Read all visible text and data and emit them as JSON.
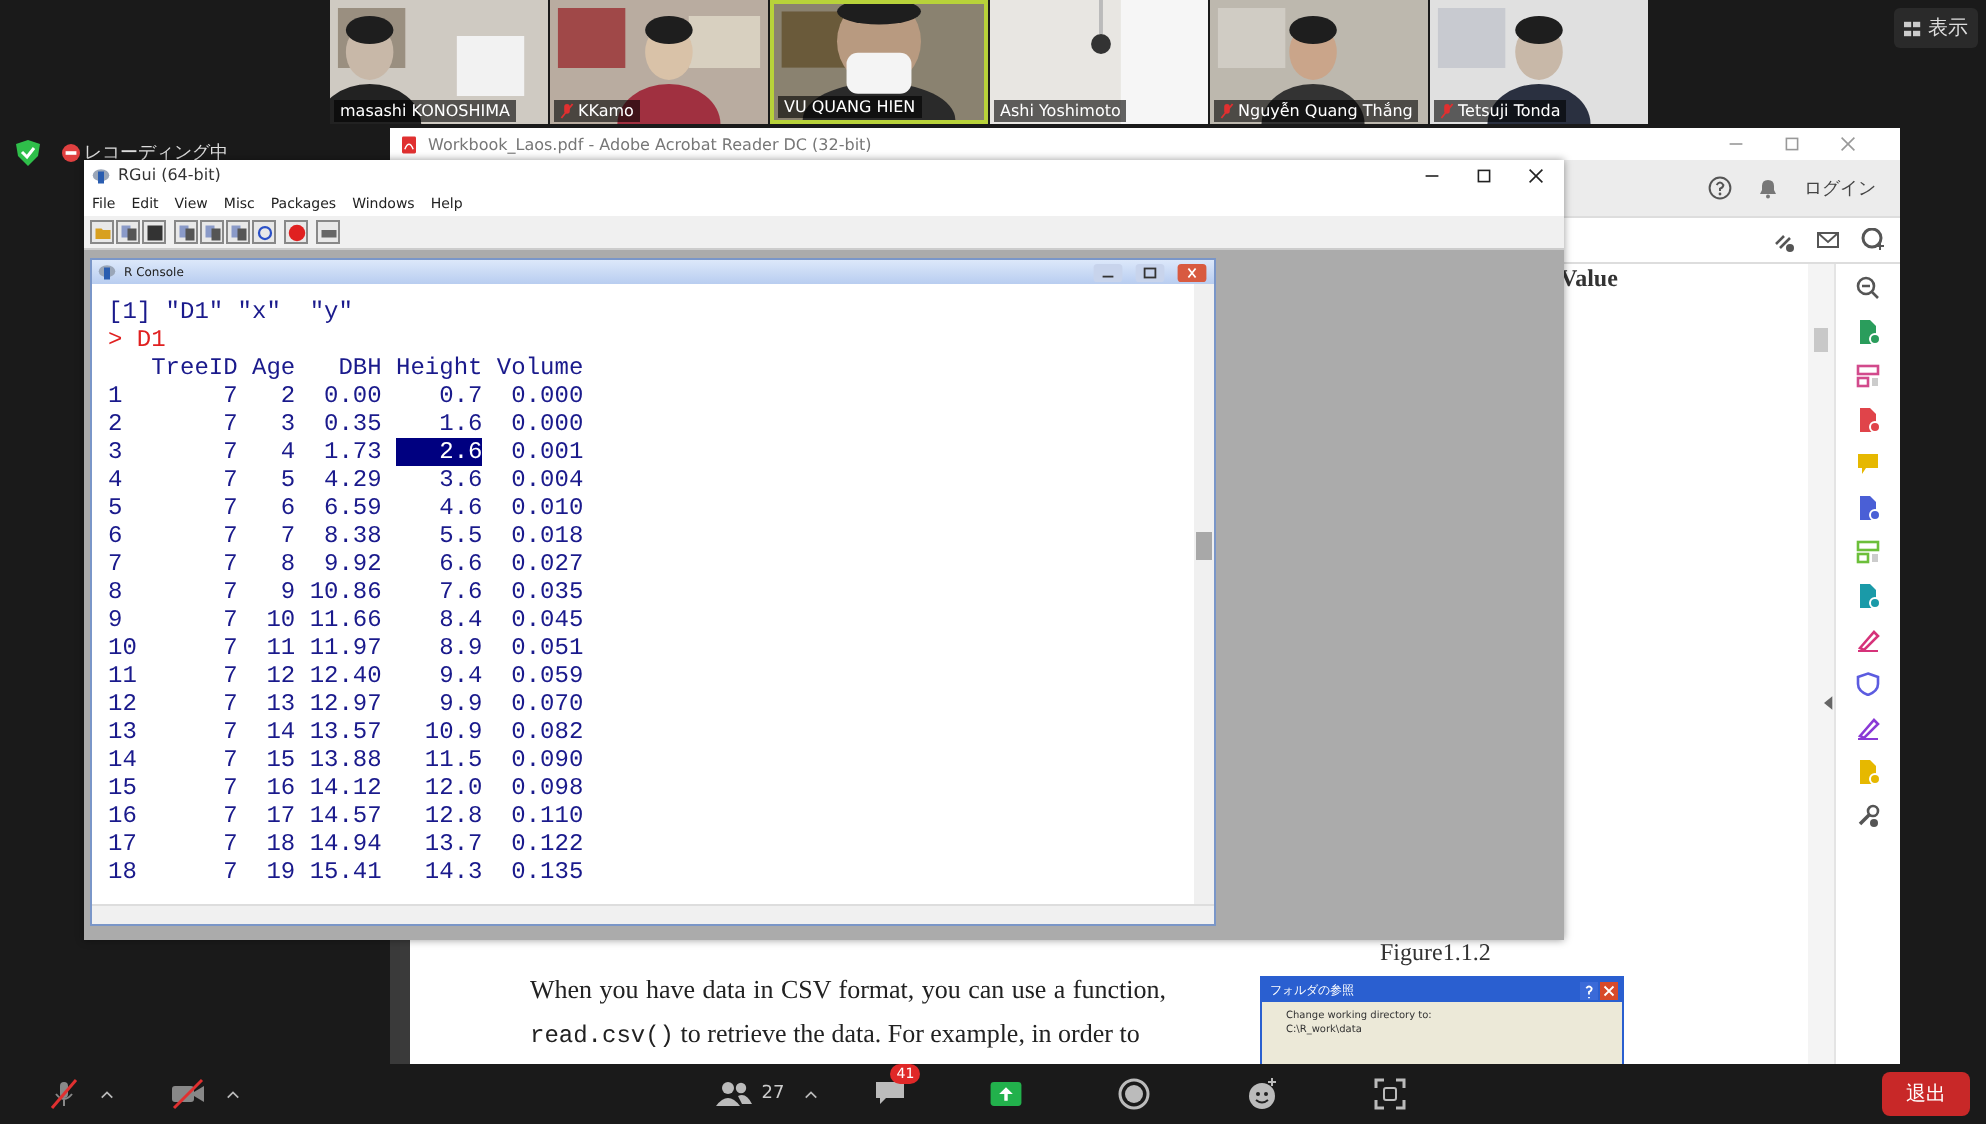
{
  "participants": [
    {
      "name": "masashi KONOSHIMA",
      "muted": false,
      "speaking": false
    },
    {
      "name": "KKamo",
      "muted": true,
      "speaking": false
    },
    {
      "name": "VU QUANG HIEN",
      "muted": false,
      "speaking": true
    },
    {
      "name": "Ashi Yoshimoto",
      "muted": false,
      "speaking": false
    },
    {
      "name": "Nguyễn Quang Thắng",
      "muted": true,
      "speaking": false
    },
    {
      "name": "Tetsuji Tonda",
      "muted": true,
      "speaking": false
    }
  ],
  "view_button": "表示",
  "recording": {
    "label": "レコーディング中"
  },
  "acrobat": {
    "title": "Workbook_Laos.pdf - Adobe Acrobat Reader DC (32-bit)",
    "login": "ログイン",
    "heading": "Value",
    "figure_caption": "Figure1.1.2",
    "paragraph": [
      {
        "kind": "text",
        "text": "When you have data in CSV format, you can use a function, "
      },
      {
        "kind": "code",
        "text": "read.csv()"
      },
      {
        "kind": "text",
        "text": " to retrieve the data.  For example, in order to"
      }
    ],
    "dialog": {
      "title": "フォルダの参照",
      "lines": [
        "Change working directory to:",
        "C:\\R_work\\data"
      ]
    }
  },
  "rgui": {
    "title": "RGui (64-bit)",
    "menu": [
      "File",
      "Edit",
      "View",
      "Misc",
      "Packages",
      "Windows",
      "Help"
    ],
    "console": {
      "title": "R Console",
      "output": "[1] \"D1\" \"x\"  \"y\"",
      "command": "> D1",
      "columns": [
        "",
        "TreeID",
        "Age",
        "DBH",
        "Height",
        "Volume"
      ],
      "rows": [
        {
          "cells": [
            "1",
            "7",
            "2",
            "0.00",
            "0.7",
            "0.000"
          ],
          "height_selected": false
        },
        {
          "cells": [
            "2",
            "7",
            "3",
            "0.35",
            "1.6",
            "0.000"
          ],
          "height_selected": false
        },
        {
          "cells": [
            "3",
            "7",
            "4",
            "1.73",
            "2.6",
            "0.001"
          ],
          "height_selected": true
        },
        {
          "cells": [
            "4",
            "7",
            "5",
            "4.29",
            "3.6",
            "0.004"
          ],
          "height_selected": false
        },
        {
          "cells": [
            "5",
            "7",
            "6",
            "6.59",
            "4.6",
            "0.010"
          ],
          "height_selected": false
        },
        {
          "cells": [
            "6",
            "7",
            "7",
            "8.38",
            "5.5",
            "0.018"
          ],
          "height_selected": false
        },
        {
          "cells": [
            "7",
            "7",
            "8",
            "9.92",
            "6.6",
            "0.027"
          ],
          "height_selected": false
        },
        {
          "cells": [
            "8",
            "7",
            "9",
            "10.86",
            "7.6",
            "0.035"
          ],
          "height_selected": false
        },
        {
          "cells": [
            "9",
            "7",
            "10",
            "11.66",
            "8.4",
            "0.045"
          ],
          "height_selected": false
        },
        {
          "cells": [
            "10",
            "7",
            "11",
            "11.97",
            "8.9",
            "0.051"
          ],
          "height_selected": false
        },
        {
          "cells": [
            "11",
            "7",
            "12",
            "12.40",
            "9.4",
            "0.059"
          ],
          "height_selected": false
        },
        {
          "cells": [
            "12",
            "7",
            "13",
            "12.97",
            "9.9",
            "0.070"
          ],
          "height_selected": false
        },
        {
          "cells": [
            "13",
            "7",
            "14",
            "13.57",
            "10.9",
            "0.082"
          ],
          "height_selected": false
        },
        {
          "cells": [
            "14",
            "7",
            "15",
            "13.88",
            "11.5",
            "0.090"
          ],
          "height_selected": false
        },
        {
          "cells": [
            "15",
            "7",
            "16",
            "14.12",
            "12.0",
            "0.098"
          ],
          "height_selected": false
        },
        {
          "cells": [
            "16",
            "7",
            "17",
            "14.57",
            "12.8",
            "0.110"
          ],
          "height_selected": false
        },
        {
          "cells": [
            "17",
            "7",
            "18",
            "14.94",
            "13.7",
            "0.122"
          ],
          "height_selected": false
        },
        {
          "cells": [
            "18",
            "7",
            "19",
            "15.41",
            "14.3",
            "0.135"
          ],
          "height_selected": false
        }
      ]
    }
  },
  "controls": {
    "mic_muted": true,
    "video_off": true,
    "participant_count": "27",
    "chat_badge": "41",
    "leave": "退出"
  }
}
